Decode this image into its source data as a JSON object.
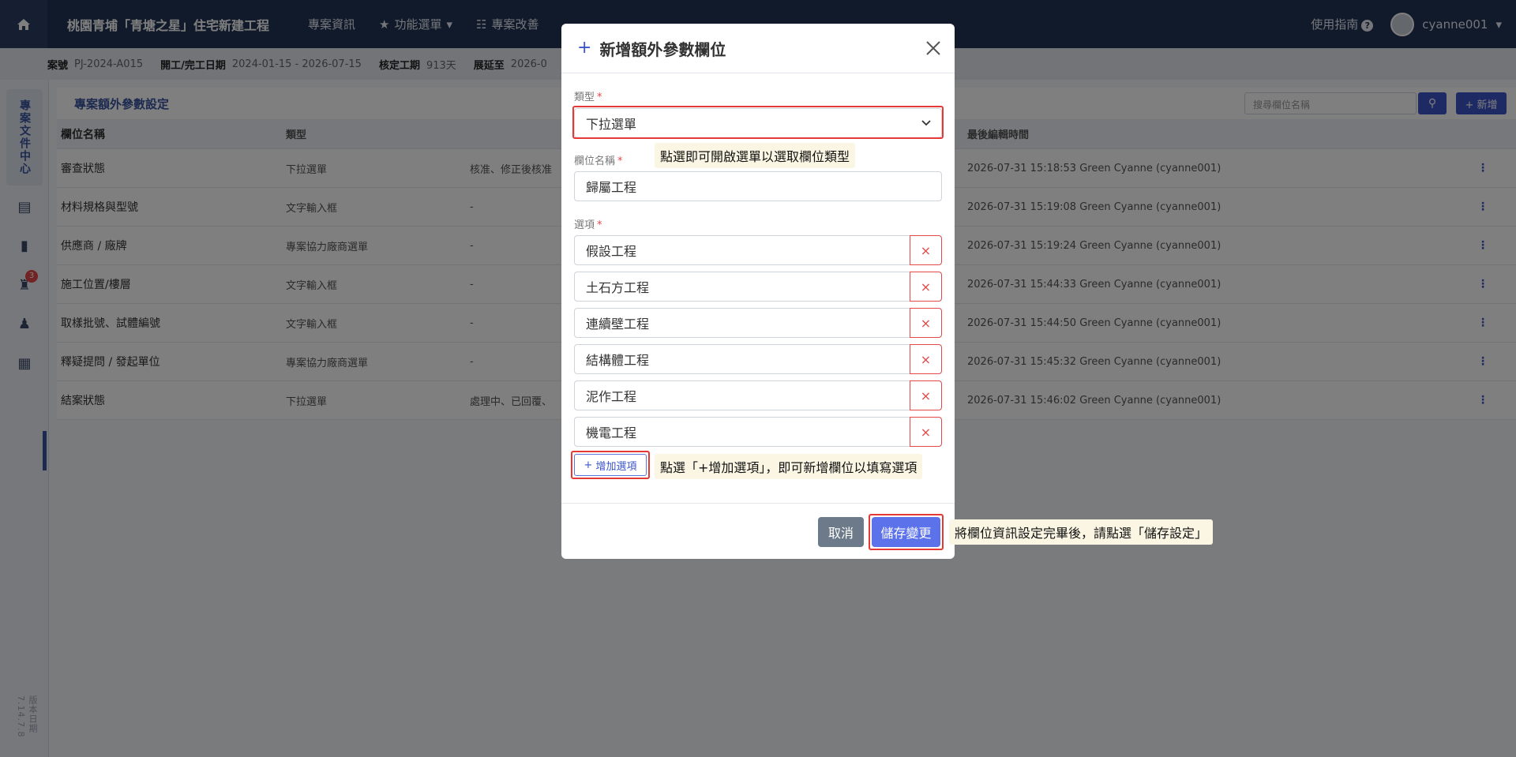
{
  "topbar": {
    "project_title": "桃園青埔「青塘之星」住宅新建工程",
    "nav": [
      "專案資訊",
      "功能選單",
      "專案改善"
    ],
    "help_label": "使用指南",
    "user_name": "cyanne001"
  },
  "infobar": {
    "items": [
      {
        "label": "案號",
        "value": "PJ-2024-A015"
      },
      {
        "label": "開工/完工日期",
        "value": "2024-01-15 - 2026-07-15"
      },
      {
        "label": "核定工期",
        "value": "913天"
      },
      {
        "label": "展延至",
        "value": "2026-0"
      }
    ]
  },
  "sidebar": {
    "tab_label": "專案文件中心",
    "badge_count": "3",
    "version": "版本日期 7.14.7.8"
  },
  "panel": {
    "title": "專案額外參數設定",
    "search_placeholder": "搜尋欄位名稱",
    "add_label": "+ 新增"
  },
  "table": {
    "headers": [
      "欄位名稱",
      "類型",
      "",
      "最後編輯時間",
      ""
    ],
    "rows": [
      {
        "name": "審查狀態",
        "type": "下拉選單",
        "options": "核准、修正後核准",
        "edited": "2026-07-31 15:18:53   Green Cyanne (cyanne001)"
      },
      {
        "name": "材料規格與型號",
        "type": "文字輸入框",
        "options": "-",
        "edited": "2026-07-31 15:19:08   Green Cyanne (cyanne001)"
      },
      {
        "name": "供應商 / 廠牌",
        "type": "專案協力廠商選單",
        "options": "-",
        "edited": "2026-07-31 15:19:24   Green Cyanne (cyanne001)"
      },
      {
        "name": "施工位置/樓層",
        "type": "文字輸入框",
        "options": "-",
        "edited": "2026-07-31 15:44:33   Green Cyanne (cyanne001)"
      },
      {
        "name": "取樣批號、試體編號",
        "type": "文字輸入框",
        "options": "-",
        "edited": "2026-07-31 15:44:50   Green Cyanne (cyanne001)"
      },
      {
        "name": "釋疑提問 / 發起單位",
        "type": "專案協力廠商選單",
        "options": "-",
        "edited": "2026-07-31 15:45:32   Green Cyanne (cyanne001)"
      },
      {
        "name": "結案狀態",
        "type": "下拉選單",
        "options": "處理中、已回覆、",
        "edited": "2026-07-31 15:46:02   Green Cyanne (cyanne001)"
      }
    ],
    "row_action": "⋮"
  },
  "modal": {
    "title": "新增額外參數欄位",
    "type_label": "類型",
    "type_value": "下拉選單",
    "name_label": "欄位名稱",
    "name_value": "歸屬工程",
    "options_label": "選項",
    "options": [
      "假設工程",
      "土石方工程",
      "連續壁工程",
      "結構體工程",
      "泥作工程",
      "機電工程"
    ],
    "remove_glyph": "×",
    "add_option_label": "增加選項",
    "cancel_label": "取消",
    "save_label": "儲存變更"
  },
  "callouts": {
    "type_hint": "點選即可開啟選單以選取欄位類型",
    "add_option_hint": "點選「+增加選項」，即可新增欄位以填寫選項",
    "save_hint": "將欄位資訊設定完畢後，請點選「儲存設定」"
  },
  "colors": {
    "topbar": "#233456",
    "accent": "#3b55c8",
    "danger": "#e54848",
    "highlight": "#e53935",
    "callout_bg": "#fbf6e4"
  }
}
